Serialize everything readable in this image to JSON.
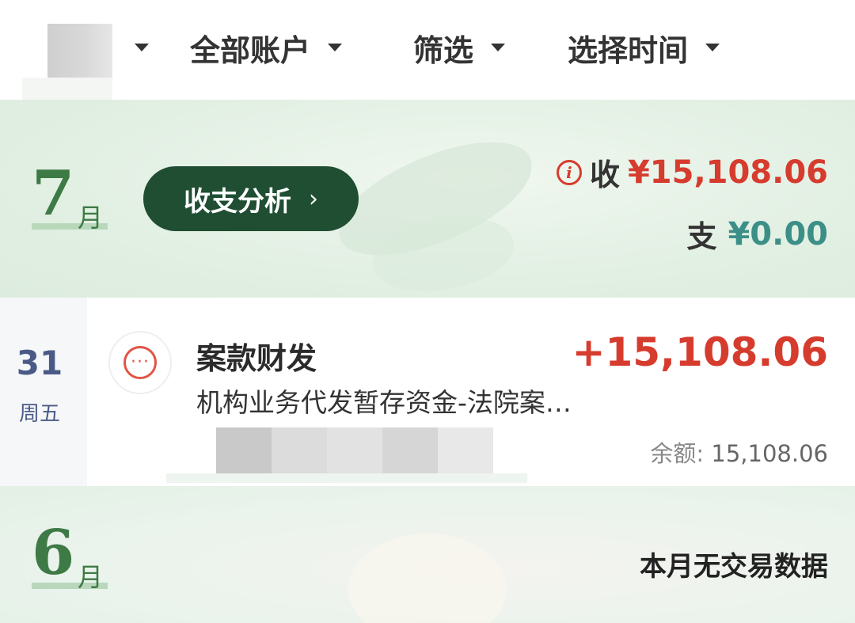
{
  "filter_bar": {
    "filters": [
      {
        "label": "全部账户"
      },
      {
        "label": "筛选"
      },
      {
        "label": "选择时间"
      }
    ]
  },
  "months": [
    {
      "month_number": "7",
      "month_suffix": "月",
      "analysis_button": {
        "label": "收支分析",
        "chevron": "›"
      },
      "income_label": "收",
      "income_amount": "¥15,108.06",
      "expense_label": "支",
      "expense_amount": "¥0.00",
      "transactions": [
        {
          "day": "31",
          "weekday": "周五",
          "icon": "more-dots-icon",
          "title": "案款财发",
          "description": "机构业务代发暂存资金-法院案…",
          "amount": "+15,108.06",
          "balance_label": "余额:",
          "balance_value": "15,108.06"
        }
      ]
    },
    {
      "month_number": "6",
      "month_suffix": "月",
      "empty_text": "本月无交易数据"
    }
  ],
  "colors": {
    "income_red": "#d63c2e",
    "expense_teal": "#3b8f87",
    "button_green": "#1f4e33",
    "month_green": "#3e7a45"
  }
}
